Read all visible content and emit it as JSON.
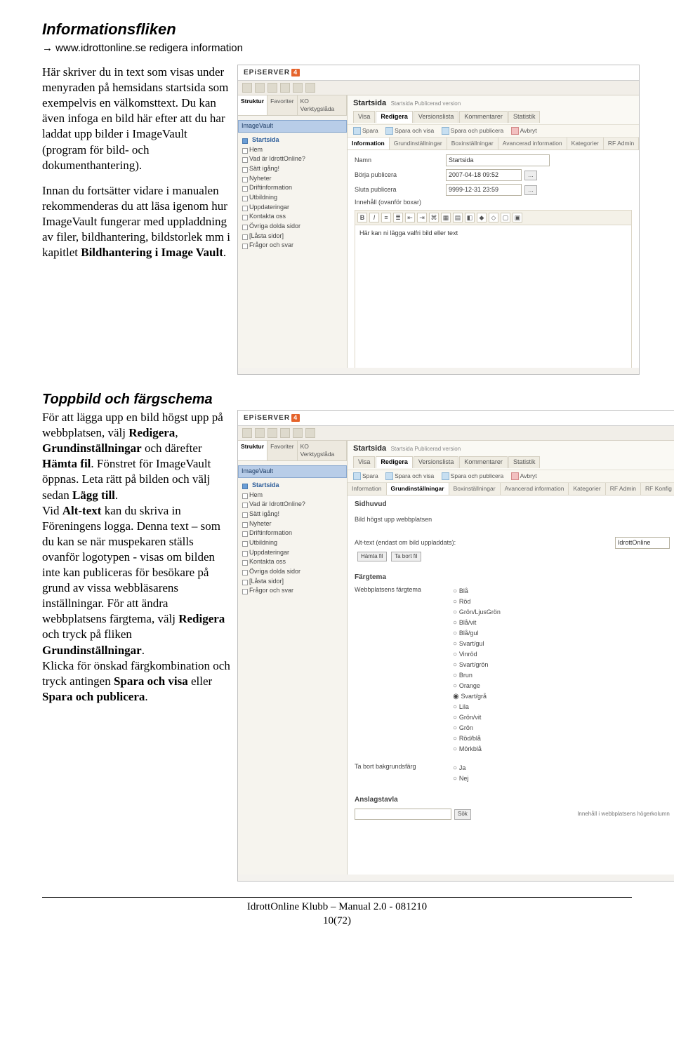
{
  "doc": {
    "heading1": "Informationsfliken",
    "url_line_prefix": "→",
    "url_line": "www.idrottonline.se redigera information",
    "intro_p1": "Här skriver du in text som visas under menyraden på hemsidans startsida som exempelvis en välkomsttext. Du kan även infoga en bild här efter att du har laddat upp bilder i ImageVault (program för bild- och dokumenthantering).",
    "intro_p2_pre": "Innan du fortsätter vidare i manualen rekommenderas du att läsa igenom hur ImageVault fungerar med uppladdning av filer, bildhantering, bildstorlek mm i kapitlet ",
    "intro_p2_bold": "Bildhantering i Image Vault",
    "intro_p2_post": ".",
    "heading2": "Toppbild och färgschema",
    "p2_parts": {
      "t1": "För att lägga upp en bild högst upp på webbplatsen, välj ",
      "b1": "Redigera",
      "t2": ", ",
      "b2": "Grundinställningar",
      "t3": " och därefter ",
      "b3": "Hämta fil",
      "t4": ". Fönstret för ImageVault öppnas. Leta rätt på bilden och välj sedan ",
      "b4": "Lägg till",
      "t5": ".",
      "t6": "Vid ",
      "b5": "Alt-text",
      "t7": " kan du skriva in Föreningens logga. Denna text – som du kan se när muspekaren ställs ovanför logotypen - visas om bilden inte kan publiceras för besökare på grund av vissa webbläsarens inställningar. För att ändra webbplatsens färgtema, välj ",
      "b6": "Redigera",
      "t8": " och tryck på fliken ",
      "b7": "Grundinställningar",
      "t9": ".",
      "t10": "Klicka för önskad färgkombination och tryck antingen ",
      "b8": "Spara och visa",
      "t11": " eller ",
      "b9": "Spara och publicera",
      "t12": "."
    },
    "footer1": "IdrottOnline Klubb – Manual  2.0 - 081210",
    "footer2": "10(72)"
  },
  "ss": {
    "logo": "EPiSERVER",
    "logo_suffix": "4",
    "left_tabs": [
      "Struktur",
      "Favoriter",
      "KO Verktygslåda"
    ],
    "imagevault_label": "ImageVault",
    "tree": {
      "root": "Startsida",
      "items": [
        "Hem",
        "Vad är IdrottOnline?",
        "Sätt igång!",
        "Nyheter",
        "Driftinformation",
        "Utbildning",
        "Uppdateringar",
        "Kontakta oss",
        "Övriga dolda sidor",
        "[Låsta sidor]",
        "Frågor och svar"
      ]
    },
    "page_title": "Startsida",
    "page_meta": "Startsida  Publicerad version",
    "view_tabs": [
      "Visa",
      "Redigera",
      "Versionslista",
      "Kommentarer",
      "Statistik"
    ],
    "actions": [
      "Spara",
      "Spara och visa",
      "Spara och publicera",
      "Avbryt"
    ]
  },
  "ss1": {
    "sub_tabs": [
      "Information",
      "Grundinställningar",
      "Boxinställningar",
      "Avancerad information",
      "Kategorier",
      "RF Admin"
    ],
    "form": {
      "name_label": "Namn",
      "name_value": "Startsida",
      "start_label": "Börja publicera",
      "start_value": "2007-04-18 09:52",
      "stop_label": "Sluta publicera",
      "stop_value": "9999-12-31 23:59",
      "content_label": "Innehåll (ovanför boxar)",
      "editor_text": "Här kan ni lägga valfri bild eller text"
    }
  },
  "ss2": {
    "sub_tabs": [
      "Information",
      "Grundinställningar",
      "Boxinställningar",
      "Avancerad information",
      "Kategorier",
      "RF Admin",
      "RF Konfig"
    ],
    "sidhuvud_label": "Sidhuvud",
    "bild_label": "Bild högst upp webbplatsen",
    "alt_label": "Alt-text (endast om bild uppladdats):",
    "alt_value": "IdrottOnline",
    "hamta_fil": "Hämta fil",
    "ta_bort_fil": "Ta bort fil",
    "fargtema_label": "Färgtema",
    "webbfarg_label": "Webbplatsens färgtema",
    "colors": [
      "Blå",
      "Röd",
      "Grön/LjusGrön",
      "Blå/vit",
      "Blå/gul",
      "Svart/gul",
      "Vinröd",
      "Svart/grön",
      "Brun",
      "Orange",
      "Svart/grå",
      "Lila",
      "Grön/vit",
      "Grön",
      "Röd/blå",
      "Mörkblå"
    ],
    "color_checked_index": 10,
    "tabort_label": "Ta bort bakgrundsfärg",
    "ja": "Ja",
    "nej": "Nej",
    "anslagstavla": "Anslagstavla",
    "sok": "Sök",
    "innehall_label": "Innehåll i webbplatsens högerkolumn"
  }
}
